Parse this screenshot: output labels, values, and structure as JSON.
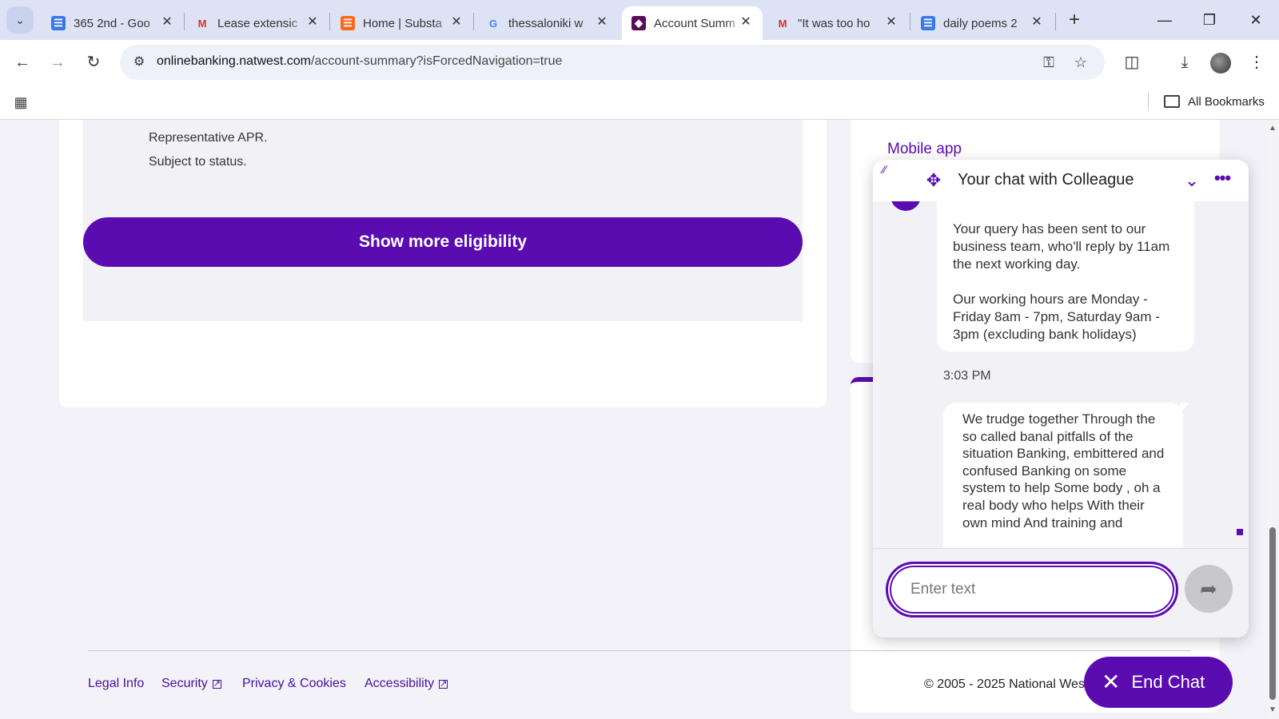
{
  "browser": {
    "tabs": [
      {
        "label": "365 2nd - Goo",
        "icon": "google-docs-icon"
      },
      {
        "label": "Lease extensic",
        "icon": "gmail-icon"
      },
      {
        "label": "Home | Substa",
        "icon": "substack-icon"
      },
      {
        "label": "thessaloniki w",
        "icon": "google-icon"
      },
      {
        "label": "Account Summ",
        "icon": "natwest-icon",
        "active": true
      },
      {
        "label": "\"It was too ho",
        "icon": "gmail-icon"
      },
      {
        "label": "daily poems 2",
        "icon": "google-docs-icon"
      }
    ],
    "url_host": "onlinebanking.natwest.com",
    "url_path": "/account-summary?isForcedNavigation=true",
    "bookmarks_label": "All Bookmarks"
  },
  "page": {
    "small_lines": [
      "Representative APR.",
      "Subject to status."
    ],
    "cta_label": "Show more eligibility",
    "mobile_app_link": "Mobile app",
    "footer": {
      "links": [
        "Legal Info",
        "Security",
        "Privacy & Cookies",
        "Accessibility"
      ],
      "copyright": "© 2005 - 2025 National Wes"
    }
  },
  "chat": {
    "title": "Your chat with Colleague",
    "agent_message_1": "Your query has been sent to our business team, who'll reply by 11am the next working day.",
    "agent_message_2": "Our working hours are Monday - Friday 8am - 7pm, Saturday 9am - 3pm (excluding bank holidays)",
    "time": "3:03 PM",
    "user_message": "We trudge together Through the so called banal pitfalls of the situation Banking, embittered and confused Banking on some system to help Some body , oh a real body who helps With their own mind And training and",
    "input_placeholder": "Enter text",
    "end_chat_label": "End Chat"
  },
  "colors": {
    "brand_purple": "#5a0cb0",
    "page_background": "#f2f2f8"
  }
}
